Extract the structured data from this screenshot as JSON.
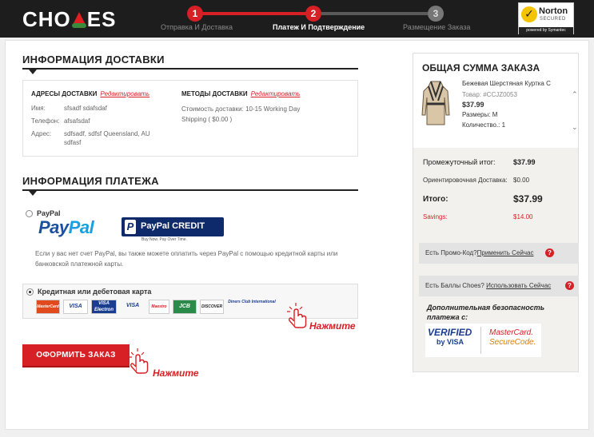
{
  "header": {
    "logo": {
      "left": "CHO",
      "right": "ES"
    },
    "steps": [
      {
        "num": "1",
        "label": "Отправка И Доставка"
      },
      {
        "num": "2",
        "label": "Платеж И Подтверждение"
      },
      {
        "num": "3",
        "label": "Размещение Заказа"
      }
    ],
    "norton": {
      "name": "Norton",
      "secured": "SECURED",
      "powered": "powered by Symantec"
    }
  },
  "shipping": {
    "title": "ИНФОРМАЦИЯ ДОСТАВКИ",
    "address_title": "АДРЕСЫ ДОСТАВКИ",
    "address_edit": "Редактировать",
    "name_label": "Имя:",
    "name_value": "sfsadf sdafsdaf",
    "phone_label": "Телефон:",
    "phone_value": "afsafsdaf",
    "addr_label": "Адрес:",
    "addr_value": "sdfsadf, sdfsf Queensland, AU sdfasf",
    "method_title": "МЕТОДЫ ДОСТАВКИ",
    "method_edit": "Редактировать",
    "method_value": "Стоимость доставки: 10-15 Working Day Shipping ( $0.00 )"
  },
  "payment": {
    "title": "ИНФОРМАЦИЯ ПЛАТЕЖА",
    "paypal_label": "PayPal",
    "paypal_logo_a": "Pay",
    "paypal_logo_b": "Pal",
    "ppcredit_text": "PayPal CREDIT",
    "ppcredit_tag": "Buy Now. Pay Over Time.",
    "paypal_note": "Если у вас нет счет PayPal, вы также можете оплатить через PayPal с помощью кредитной карты или банковской платежной карты.",
    "card_label": "Кредитная или дебетовая карта",
    "cards": [
      "MasterCard",
      "VISA",
      "VISA Electron",
      "VISA",
      "Maestro",
      "JCB",
      "DISCOVER",
      "Diners Club International"
    ],
    "hint": "Нажмите"
  },
  "submit": {
    "label": "ОФОРМИТЬ ЗАКАЗ",
    "hint": "Нажмите"
  },
  "summary": {
    "title": "ОБЩАЯ СУММА ЗАКАЗА",
    "item_name": "Бежевая Шерстяная Куртка С",
    "item_sku": "Товар: #CCJZ0053",
    "item_price": "$37.99",
    "item_size": "Размеры: M",
    "item_qty": "Количество.: 1",
    "subtotal_label": "Промежуточный итог:",
    "subtotal_value": "$37.99",
    "shipping_label": "Ориентировочная Доставка:",
    "shipping_value": "$0.00",
    "total_label": "Итого:",
    "total_value": "$37.99",
    "savings_label": "Savings:",
    "savings_value": "$14.00",
    "promo_text": "Есть Промо-Код?",
    "promo_link": "Применить Сейчас",
    "points_text": "Есть Баллы Choes?",
    "points_link": "Использовать Сейчас",
    "security_title": "Дополнительная безопасность платежа с:",
    "verified_a": "VERIFIED",
    "verified_b": "by VISA",
    "mc_a": "MasterCard.",
    "mc_b": "SecureCode."
  },
  "colors": {
    "accent": "#d71f26",
    "dark": "#1d1d1d"
  }
}
